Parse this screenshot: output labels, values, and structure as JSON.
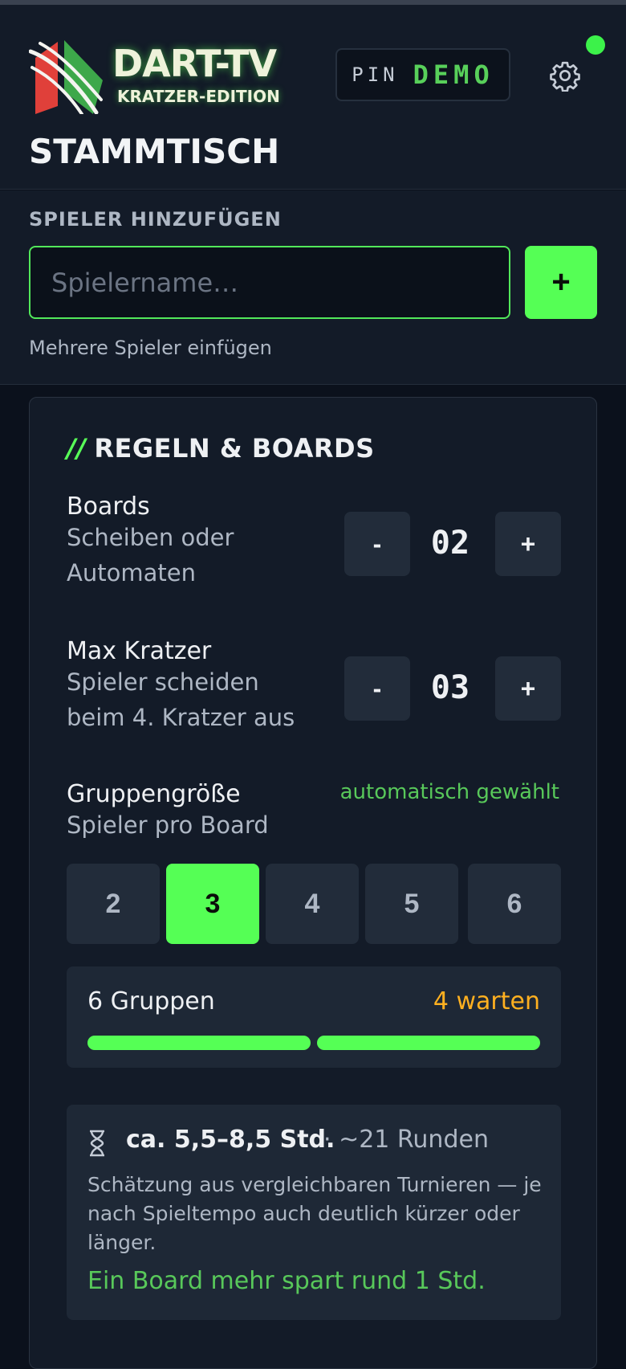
{
  "header": {
    "logo_title": "DART-TV",
    "logo_subtitle": "KRATZER-EDITION",
    "pin_label": "PIN",
    "pin_value": "DEMO",
    "page_title": "STAMMTISCH",
    "status_color": "#3cf24a"
  },
  "add_player": {
    "label": "SPIELER HINZUFÜGEN",
    "placeholder": "Spielername…",
    "value": "",
    "add_button": "+",
    "multi_link": "Mehrere Spieler einfügen"
  },
  "rules": {
    "title_prefix": "//",
    "title": "REGELN & BOARDS",
    "boards": {
      "title": "Boards",
      "subtitle": "Scheiben oder Automaten",
      "decrement": "-",
      "value": "02",
      "increment": "+"
    },
    "max_scratches": {
      "title": "Max Kratzer",
      "subtitle": "Spieler scheiden beim 4. Kratzer aus",
      "decrement": "-",
      "value": "03",
      "increment": "+"
    },
    "group_size": {
      "title": "Gruppengröße",
      "subtitle": "Spieler pro Board",
      "auto_note": "automatisch gewählt",
      "options": [
        "2",
        "3",
        "4",
        "5",
        "6"
      ],
      "selected": "3"
    },
    "summary": {
      "groups": "6 Gruppen",
      "waiting": "4 warten",
      "bar_segments_filled": 2
    },
    "estimate": {
      "duration": "ca. 5,5–8,5 Std.",
      "rounds": "· ~21 Runden",
      "note": "Schätzung aus vergleichbaren Turnieren — je nach Spieltempo auch deutlich kürzer oder länger.",
      "tip": "Ein Board mehr spart rund 1 Std."
    }
  },
  "colors": {
    "accent": "#55ff55",
    "warning": "#ffb020",
    "background": "#131b28"
  }
}
